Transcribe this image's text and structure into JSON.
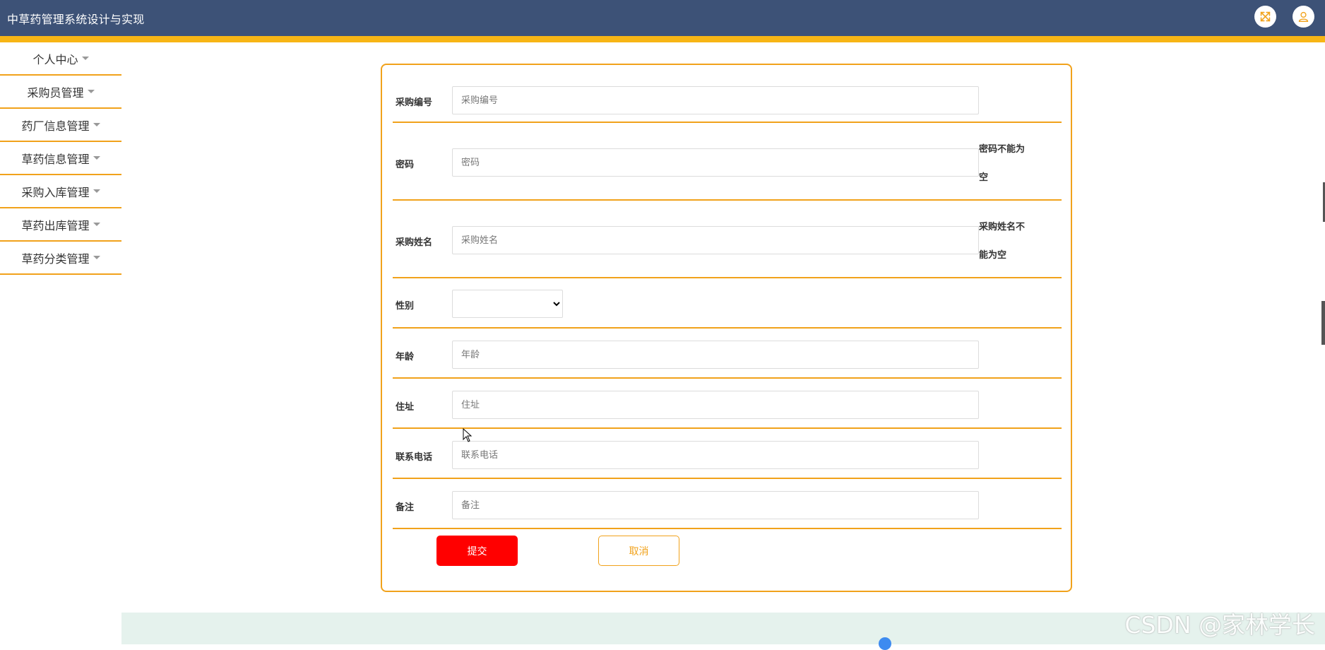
{
  "header": {
    "title": "中草药管理系统设计与实现",
    "bg_color": "#3d5277",
    "accent_color": "#f7b515",
    "fullscreen_icon": "expand-arrows-icon",
    "user_icon": "user-icon"
  },
  "sidebar": {
    "items": [
      {
        "label": "个人中心"
      },
      {
        "label": "采购员管理"
      },
      {
        "label": "药厂信息管理"
      },
      {
        "label": "草药信息管理"
      },
      {
        "label": "采购入库管理"
      },
      {
        "label": "草药出库管理"
      },
      {
        "label": "草药分类管理"
      }
    ]
  },
  "form": {
    "border_color": "#f1a21b",
    "fields": {
      "purchase_id": {
        "label": "采购编号",
        "placeholder": "采购编号",
        "value": ""
      },
      "password": {
        "label": "密码",
        "placeholder": "密码",
        "value": "",
        "error_line1": "密码不能为",
        "error_line2": "空"
      },
      "name": {
        "label": "采购姓名",
        "placeholder": "采购姓名",
        "value": "",
        "error_line1": "采购姓名不",
        "error_line2": "能为空"
      },
      "gender": {
        "label": "性别",
        "value": ""
      },
      "age": {
        "label": "年龄",
        "placeholder": "年龄",
        "value": ""
      },
      "address": {
        "label": "住址",
        "placeholder": "住址",
        "value": ""
      },
      "phone": {
        "label": "联系电话",
        "placeholder": "联系电话",
        "value": ""
      },
      "remark": {
        "label": "备注",
        "placeholder": "备注",
        "value": ""
      }
    },
    "submit_label": "提交",
    "submit_color": "#ff0000",
    "cancel_label": "取消"
  },
  "watermark": "CSDN @家林学长"
}
